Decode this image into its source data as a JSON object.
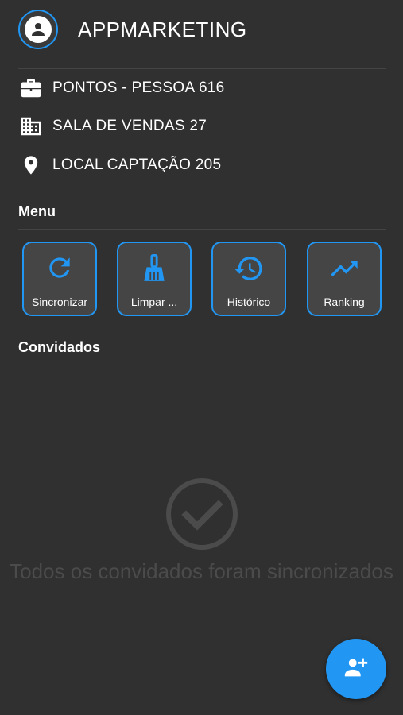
{
  "header": {
    "title": "APPMARKETING",
    "avatar_icon": "person-icon"
  },
  "info": [
    {
      "icon": "briefcase-icon",
      "text": "PONTOS - PESSOA 616"
    },
    {
      "icon": "building-icon",
      "text": "SALA DE VENDAS 27"
    },
    {
      "icon": "location-pin-icon",
      "text": "LOCAL CAPTAÇÃO 205"
    }
  ],
  "menu": {
    "title": "Menu",
    "buttons": [
      {
        "label": "Sincronizar",
        "icon": "sync-icon"
      },
      {
        "label": "Limpar ...",
        "icon": "broom-icon"
      },
      {
        "label": "Histórico",
        "icon": "history-icon"
      },
      {
        "label": "Ranking",
        "icon": "trending-up-icon"
      }
    ]
  },
  "guests": {
    "title": "Convidados",
    "empty_icon": "check-circle-icon",
    "empty_text": "Todos os convidados foram sincronizados"
  },
  "fab": {
    "icon": "add-person-icon"
  },
  "colors": {
    "accent": "#2196f3",
    "background": "#303030",
    "button_bg": "#454545",
    "muted": "#4b4b4b"
  }
}
